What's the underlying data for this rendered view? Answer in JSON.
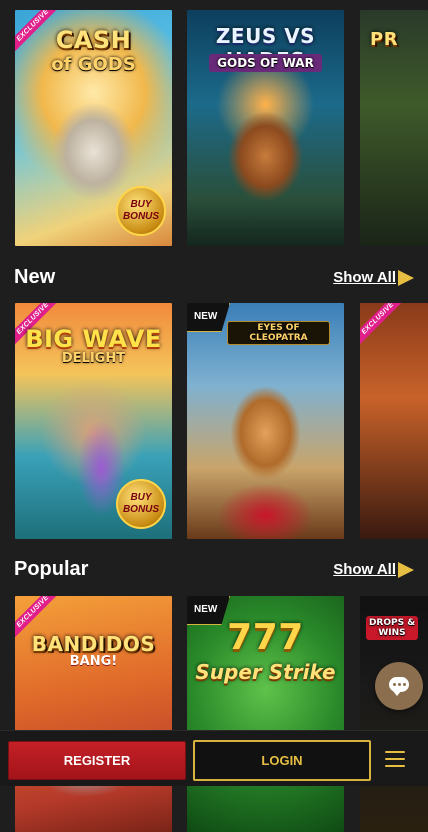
{
  "sections": {
    "new": {
      "title": "New",
      "show_all": "Show All"
    },
    "popular": {
      "title": "Popular",
      "show_all": "Show All"
    }
  },
  "games": {
    "row1": [
      {
        "name": "Cash of Gods",
        "title": "CASH",
        "sub": "of GODS",
        "ribbon": "EXCLUSIVE",
        "bonus": "BUY BONUS"
      },
      {
        "name": "Zeus vs Hades Gods of War",
        "title": "ZEUS VS HADES",
        "sub": "GODS OF WAR"
      },
      {
        "name": "Partial game tile",
        "title": "PR"
      }
    ],
    "row2": [
      {
        "name": "Big Wave Delight",
        "title": "BIG WAVE",
        "sub": "DELIGHT",
        "ribbon": "EXCLUSIVE",
        "bonus": "BUY BONUS"
      },
      {
        "name": "Eyes of Cleopatra",
        "title": "",
        "sub": "EYES OF CLEOPATRA",
        "badge": "NEW"
      },
      {
        "name": "Partial game tile",
        "ribbon": "EXCLUSIVE"
      }
    ],
    "row3": [
      {
        "name": "Bandidos Bang",
        "title": "BANDIDOS",
        "sub": "BANG!",
        "ribbon": "EXCLUSIVE"
      },
      {
        "name": "Super Strike 777",
        "title": "777",
        "sub": "Super Strike",
        "badge": "NEW"
      },
      {
        "name": "Drops & Wins tile",
        "sub": "DROPS & WINS"
      }
    ]
  },
  "footer": {
    "register": "REGISTER",
    "login": "LOGIN"
  },
  "icons": {
    "chat": "chat-bubble-icon",
    "menu": "hamburger-menu-icon",
    "show_all": "chevron-right-icon"
  },
  "colors": {
    "accent": "#e6bf42",
    "register": "#c42027",
    "background": "#1e1e1e",
    "exclusive": "#e01f8a"
  }
}
